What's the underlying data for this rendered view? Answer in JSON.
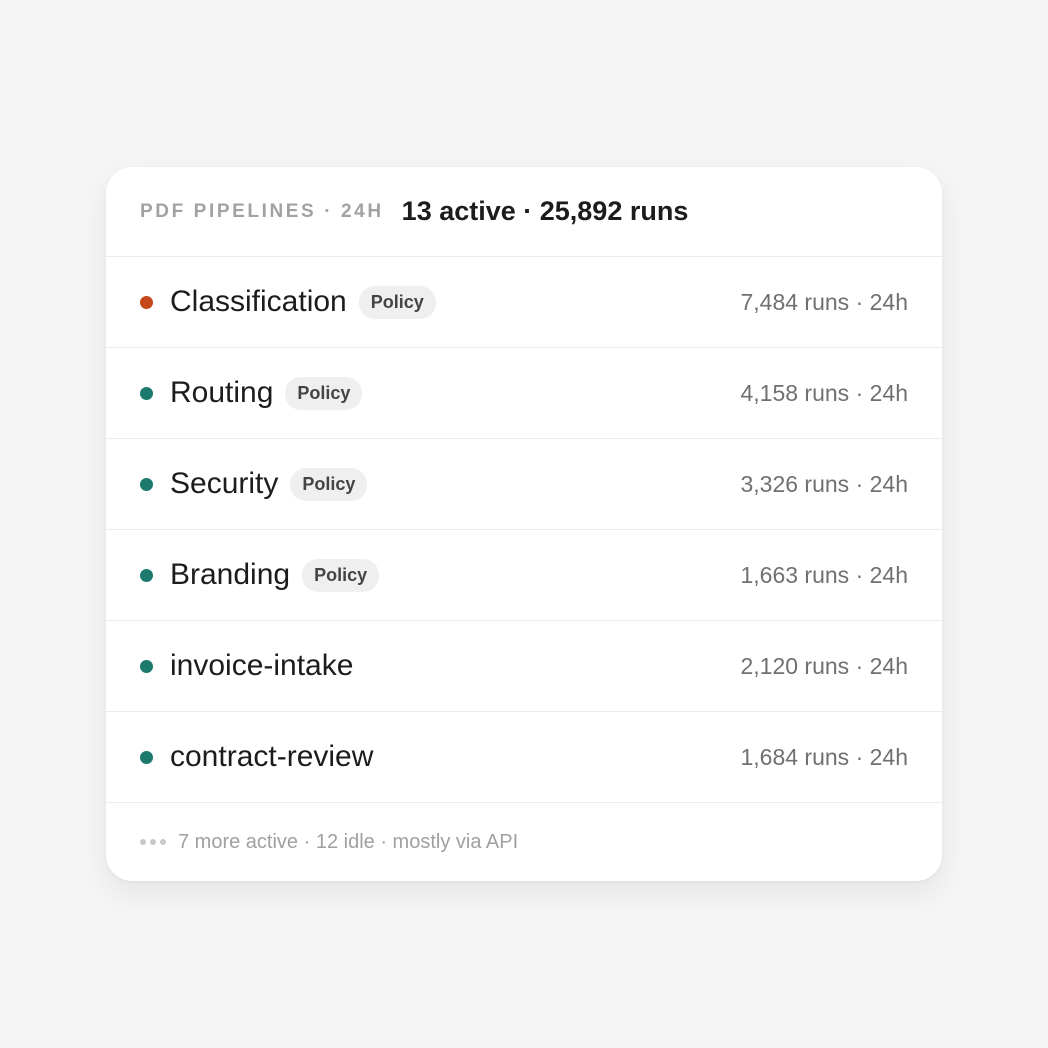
{
  "colors": {
    "status_warning": "#c4491a",
    "status_ok": "#1b7a6d"
  },
  "header": {
    "eyebrow": "PDF PIPELINES · 24H",
    "summary": "13 active · 25,892 runs"
  },
  "pipelines": [
    {
      "name": "Classification",
      "badge": "Policy",
      "runs": "7,484 runs · 24h",
      "status_color": "#c4491a"
    },
    {
      "name": "Routing",
      "badge": "Policy",
      "runs": "4,158 runs · 24h",
      "status_color": "#1b7a6d"
    },
    {
      "name": "Security",
      "badge": "Policy",
      "runs": "3,326 runs · 24h",
      "status_color": "#1b7a6d"
    },
    {
      "name": "Branding",
      "badge": "Policy",
      "runs": "1,663 runs · 24h",
      "status_color": "#1b7a6d"
    },
    {
      "name": "invoice-intake",
      "badge": null,
      "runs": "2,120 runs · 24h",
      "status_color": "#1b7a6d"
    },
    {
      "name": "contract-review",
      "badge": null,
      "runs": "1,684 runs · 24h",
      "status_color": "#1b7a6d"
    }
  ],
  "footer": {
    "icon": "more-dots-icon",
    "text": "7 more active · 12 idle · mostly via API"
  }
}
